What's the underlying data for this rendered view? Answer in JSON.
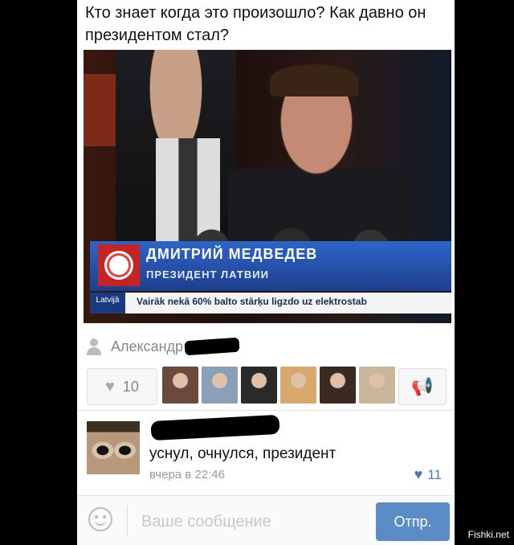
{
  "post": {
    "text": "Кто знает когда это произошло?  Как давно он президентом стал?"
  },
  "photo": {
    "caption_name": "ДМИТРИЙ МЕДВЕДЕВ",
    "caption_title": "ПРЕЗИДЕНТ ЛАТВИИ",
    "ticker_country": "Latvijā",
    "ticker_text": "Vairāk nekā 60% balto stārķu ligzdo uz elektrostab"
  },
  "author": {
    "name": "Александр",
    "icon": "person-icon"
  },
  "actions": {
    "like_count": "10",
    "like_icon": "heart-icon",
    "share_icon": "megaphone-icon",
    "avatar_colors": [
      "#6a4a3a",
      "#8aa0b8",
      "#2a2a2a",
      "#d9a86c",
      "#3a2a22",
      "#c9b79a"
    ]
  },
  "comment": {
    "text": "уснул, очнулся, президент",
    "time": "вчера в 22:46",
    "likes": "11"
  },
  "compose": {
    "placeholder": "Ваше сообщение",
    "send_label": "Отпр."
  },
  "watermark": "Fishki.net",
  "colors": {
    "accent": "#5b8cc6",
    "like_blue": "#4a78b4"
  }
}
